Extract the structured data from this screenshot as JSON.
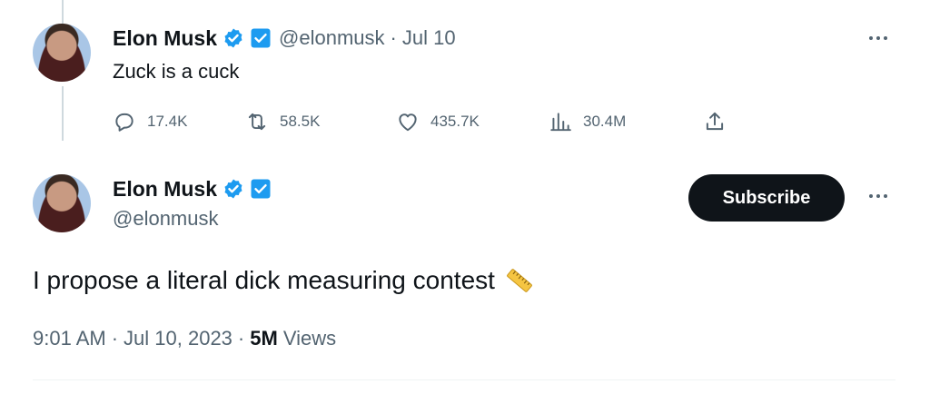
{
  "tweet1": {
    "display_name": "Elon Musk",
    "handle": "@elonmusk",
    "separator": "·",
    "date": "Jul 10",
    "text": "Zuck is a cuck",
    "actions": {
      "replies": "17.4K",
      "retweets": "58.5K",
      "likes": "435.7K",
      "views": "30.4M"
    }
  },
  "tweet2": {
    "display_name": "Elon Musk",
    "handle": "@elonmusk",
    "subscribe_label": "Subscribe",
    "text": "I propose a literal dick measuring contest",
    "time": "9:01 AM",
    "separator": "·",
    "date": "Jul 10, 2023",
    "separator2": "·",
    "views_count": "5M",
    "views_label": "Views"
  },
  "icons": {
    "verified": "verified-badge-icon",
    "square_badge": "affiliate-badge-icon",
    "reply": "reply-icon",
    "retweet": "retweet-icon",
    "like": "heart-icon",
    "views": "analytics-icon",
    "share": "share-icon",
    "more": "more-icon",
    "ruler": "ruler-emoji-icon"
  },
  "colors": {
    "accent": "#1d9bf0",
    "text": "#0f1419",
    "secondary": "#536471",
    "button_bg": "#0f1419"
  }
}
